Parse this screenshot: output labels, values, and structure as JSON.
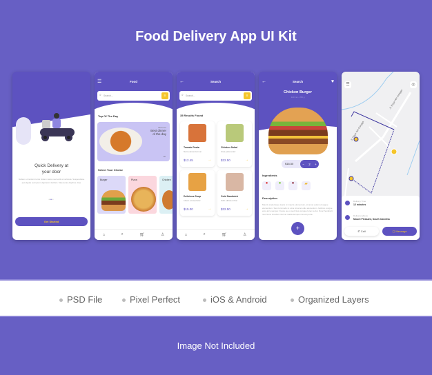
{
  "title": "Food Delivery App UI Kit",
  "screens": {
    "onboarding": {
      "heading1": "Quick Delivery at",
      "heading2": "your door",
      "body": "Nullam a tincidunt tortor. Etiam varius sed velit at vehicula. Suspendisse quis ligula sed ipsum dignissim facilisis. Maecenas dapibus vitae",
      "button": "Get Started",
      "page_index": 2,
      "page_count": 3
    },
    "home": {
      "title": "Food",
      "search_placeholder": "Search...",
      "top_section": "Top Of The Day",
      "promo_kicker": "Discover",
      "promo_title1": "Best dinner",
      "promo_title2": "of the day",
      "choice_section": "Select Your Choise",
      "categories": [
        "Burger",
        "Pizza",
        "Chicken"
      ]
    },
    "results": {
      "title": "Search",
      "search_placeholder": "Search...",
      "count": "35 Results Found",
      "items": [
        {
          "name": "Tomato Pasta",
          "desc": "Nam elementum an",
          "price": "$12.45"
        },
        {
          "name": "Chicken Salad",
          "desc": "Cras justo tortor",
          "price": "$22.50"
        },
        {
          "name": "Delicious Soup",
          "desc": "Libero consectetur",
          "price": "$15.00"
        },
        {
          "name": "Cold Sandwich",
          "desc": "Odio ultricies rhon",
          "price": "$32.50"
        }
      ]
    },
    "detail": {
      "title": "Search",
      "name": "Chicken Burger",
      "meta": "120 cal - 350 g",
      "price": "$16.50",
      "quantity": "2",
      "minus": "−",
      "plus": "+",
      "ingredients_label": "Ingredients",
      "description_label": "Description",
      "description": "Mauris scelerisque turpis ut mauris elementum, sit amet euismod augue elementum. Sed commodo ut urna sit amet odio elementum, facilisis congue eros arcu semper. Fusce eu ex sed risus congue lorem a dui. Nunc hendrerit nisl. Nunc tincidunt nisl vel mattis tempus nisi vel porta."
    },
    "tracking": {
      "street1": "Jl. Raya Yeh Gangga",
      "street2": "Jl. Raya Yeh Gangga",
      "time_label": "Delivery Time",
      "time_value": "12 minutes",
      "address_label": "Delivery Adress",
      "address_value": "Mount Pleasant, South Carolina",
      "call": "Call",
      "message": "Message"
    }
  },
  "features": [
    "PSD File",
    "Pixel Perfect",
    "iOS & Android",
    "Organized Layers"
  ],
  "footer": "Image Not Included",
  "colors": {
    "background": "#675fc4",
    "primary": "#5d52c0",
    "accent": "#f5c52a"
  }
}
